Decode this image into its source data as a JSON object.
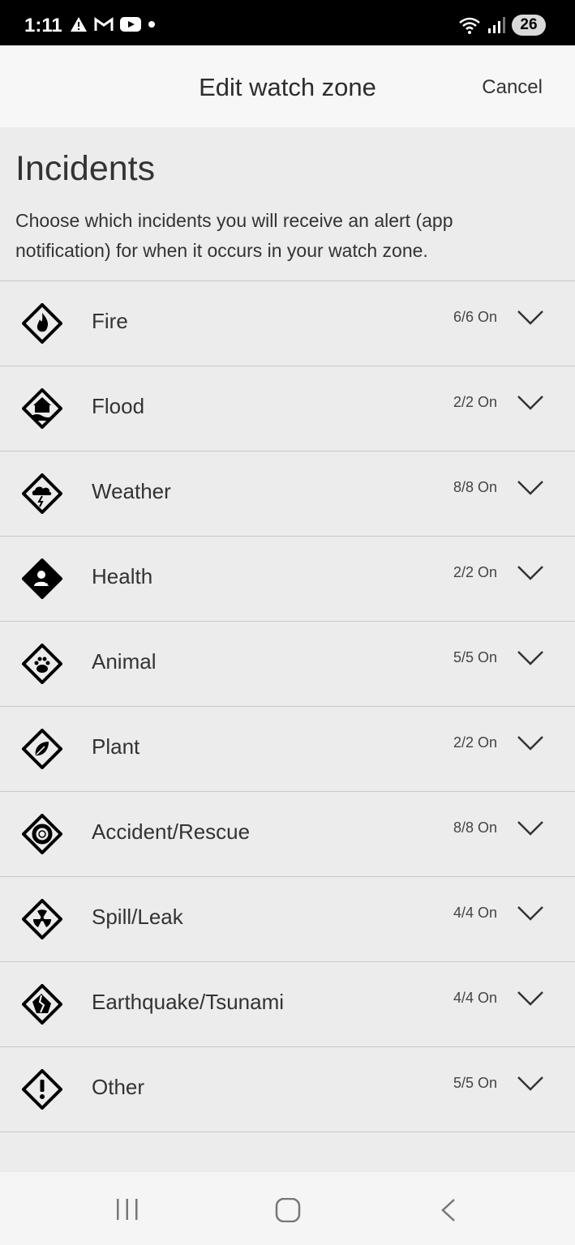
{
  "status_bar": {
    "time": "1:11",
    "battery": "26",
    "left_icons": [
      "warning-icon",
      "gmail-icon",
      "youtube-icon",
      "dot-icon"
    ],
    "right_icons": [
      "wifi-icon",
      "signal-icon"
    ]
  },
  "header": {
    "title": "Edit watch zone",
    "cancel_label": "Cancel"
  },
  "section": {
    "title": "Incidents",
    "description": "Choose which incidents you will receive an alert (app notification) for when it occurs in your watch zone."
  },
  "incidents": [
    {
      "label": "Fire",
      "count": "6/6 On",
      "icon": "fire-icon"
    },
    {
      "label": "Flood",
      "count": "2/2 On",
      "icon": "flood-icon"
    },
    {
      "label": "Weather",
      "count": "8/8 On",
      "icon": "weather-icon"
    },
    {
      "label": "Health",
      "count": "2/2 On",
      "icon": "health-icon"
    },
    {
      "label": "Animal",
      "count": "5/5 On",
      "icon": "animal-icon"
    },
    {
      "label": "Plant",
      "count": "2/2 On",
      "icon": "plant-icon"
    },
    {
      "label": "Accident/Rescue",
      "count": "8/8 On",
      "icon": "rescue-icon"
    },
    {
      "label": "Spill/Leak",
      "count": "4/4 On",
      "icon": "spill-icon"
    },
    {
      "label": "Earthquake/Tsunami",
      "count": "4/4 On",
      "icon": "earthquake-icon"
    },
    {
      "label": "Other",
      "count": "5/5 On",
      "icon": "other-icon"
    }
  ],
  "nav_bar": {
    "buttons": [
      "recents-icon",
      "home-icon",
      "back-icon"
    ]
  }
}
